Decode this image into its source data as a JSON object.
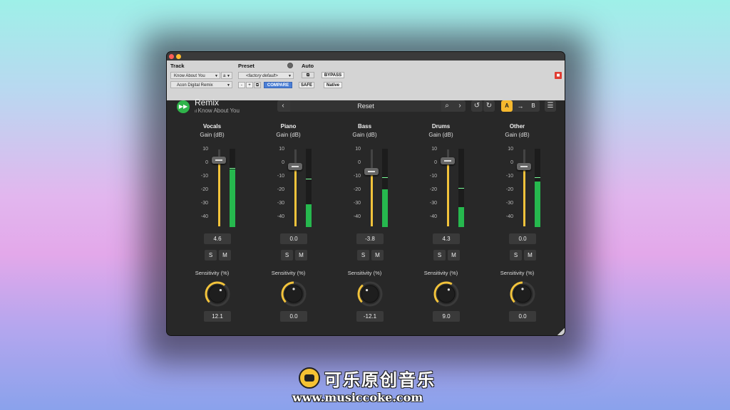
{
  "header": {
    "track_label": "Track",
    "preset_label": "Preset",
    "auto_label": "Auto",
    "track_name": "Know About You",
    "track_slot": "a",
    "insert_name": "Acon Digital Remix",
    "preset_value": "<factory default>",
    "minus": "-",
    "plus": "+",
    "compare": "COMPARE",
    "bypass": "BYPASS",
    "safe": "SAFE",
    "native": "Native"
  },
  "plugin": {
    "title": "Remix",
    "subtitle": "Know About You",
    "preset_name": "Reset",
    "ab_a": "A",
    "ab_b": "B"
  },
  "labels": {
    "gain": "Gain (dB)",
    "sensitivity": "Sensitivity (%)",
    "solo": "S",
    "mute": "M",
    "ticks": [
      "10",
      "0",
      "-10",
      "-20",
      "-30",
      "-40"
    ]
  },
  "channels": [
    {
      "name": "Vocals",
      "gain": "4.6",
      "sensitivity": "12.1",
      "gain_db": 4.6,
      "meter_db": -5,
      "meter_peak_db": -4,
      "sens_pct": 12.1
    },
    {
      "name": "Piano",
      "gain": "0.0",
      "sensitivity": "0.0",
      "gain_db": 0.0,
      "meter_db": -31,
      "meter_peak_db": -12,
      "sens_pct": 0.0
    },
    {
      "name": "Bass",
      "gain": "-3.8",
      "sensitivity": "-12.1",
      "gain_db": -3.8,
      "meter_db": -20,
      "meter_peak_db": -11,
      "sens_pct": -12.1
    },
    {
      "name": "Drums",
      "gain": "4.3",
      "sensitivity": "9.0",
      "gain_db": 4.3,
      "meter_db": -33,
      "meter_peak_db": -19,
      "sens_pct": 9.0
    },
    {
      "name": "Other",
      "gain": "0.0",
      "sensitivity": "0.0",
      "gain_db": 0.0,
      "meter_db": -14,
      "meter_peak_db": -11,
      "sens_pct": 0.0
    }
  ],
  "colors": {
    "accent": "#f2c33b",
    "meter": "#26b84e",
    "logo": "#2fb44a",
    "close": "#e03c32",
    "compare": "#4a7fd6"
  },
  "watermark": {
    "cn": "可乐原创音乐",
    "url": "www.musiccoke.com"
  }
}
